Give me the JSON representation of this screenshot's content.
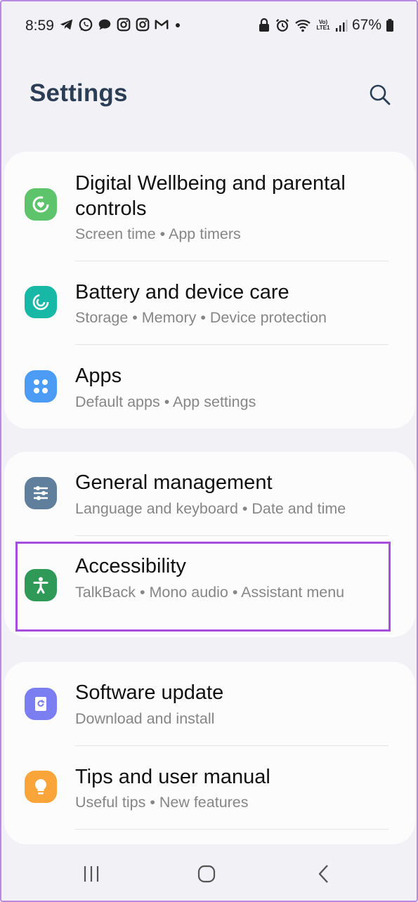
{
  "status_bar": {
    "time": "8:59",
    "battery_percent": "67%",
    "network_label": "Vo) LTE1",
    "left_icons": [
      "telegram-icon",
      "whatsapp-icon",
      "chat-icon",
      "instagram-icon",
      "instagram-icon",
      "gmail-icon",
      "dot-icon"
    ],
    "right_icons": [
      "lock-icon",
      "alarm-icon",
      "wifi-icon",
      "signal-icon",
      "battery-icon"
    ]
  },
  "header": {
    "title": "Settings",
    "search_icon": "search-icon"
  },
  "groups": [
    {
      "items": [
        {
          "title": "Digital Wellbeing and parental controls",
          "subtitle": "Screen time  •  App timers",
          "icon": "wellbeing-icon",
          "color": "#5dc46b"
        },
        {
          "title": "Battery and device care",
          "subtitle": "Storage  •  Memory  •  Device protection",
          "icon": "device-care-icon",
          "color": "#17b8a6"
        },
        {
          "title": "Apps",
          "subtitle": "Default apps  •  App settings",
          "icon": "apps-icon",
          "color": "#4c9cf5"
        }
      ]
    },
    {
      "items": [
        {
          "title": "General management",
          "subtitle": "Language and keyboard  •  Date and time",
          "icon": "sliders-icon",
          "color": "#5f7f9c"
        },
        {
          "title": "Accessibility",
          "subtitle": "TalkBack  •  Mono audio  •  Assistant menu",
          "icon": "accessibility-icon",
          "color": "#2f9a58"
        }
      ]
    },
    {
      "items": [
        {
          "title": "Software update",
          "subtitle": "Download and install",
          "icon": "software-update-icon",
          "color": "#7a7ef0"
        },
        {
          "title": "Tips and user manual",
          "subtitle": "Useful tips  •  New features",
          "icon": "lightbulb-icon",
          "color": "#f9a53a"
        }
      ]
    }
  ],
  "highlight_color": "#a54ee0",
  "nav_bar": [
    "recents-icon",
    "home-icon",
    "back-icon"
  ]
}
